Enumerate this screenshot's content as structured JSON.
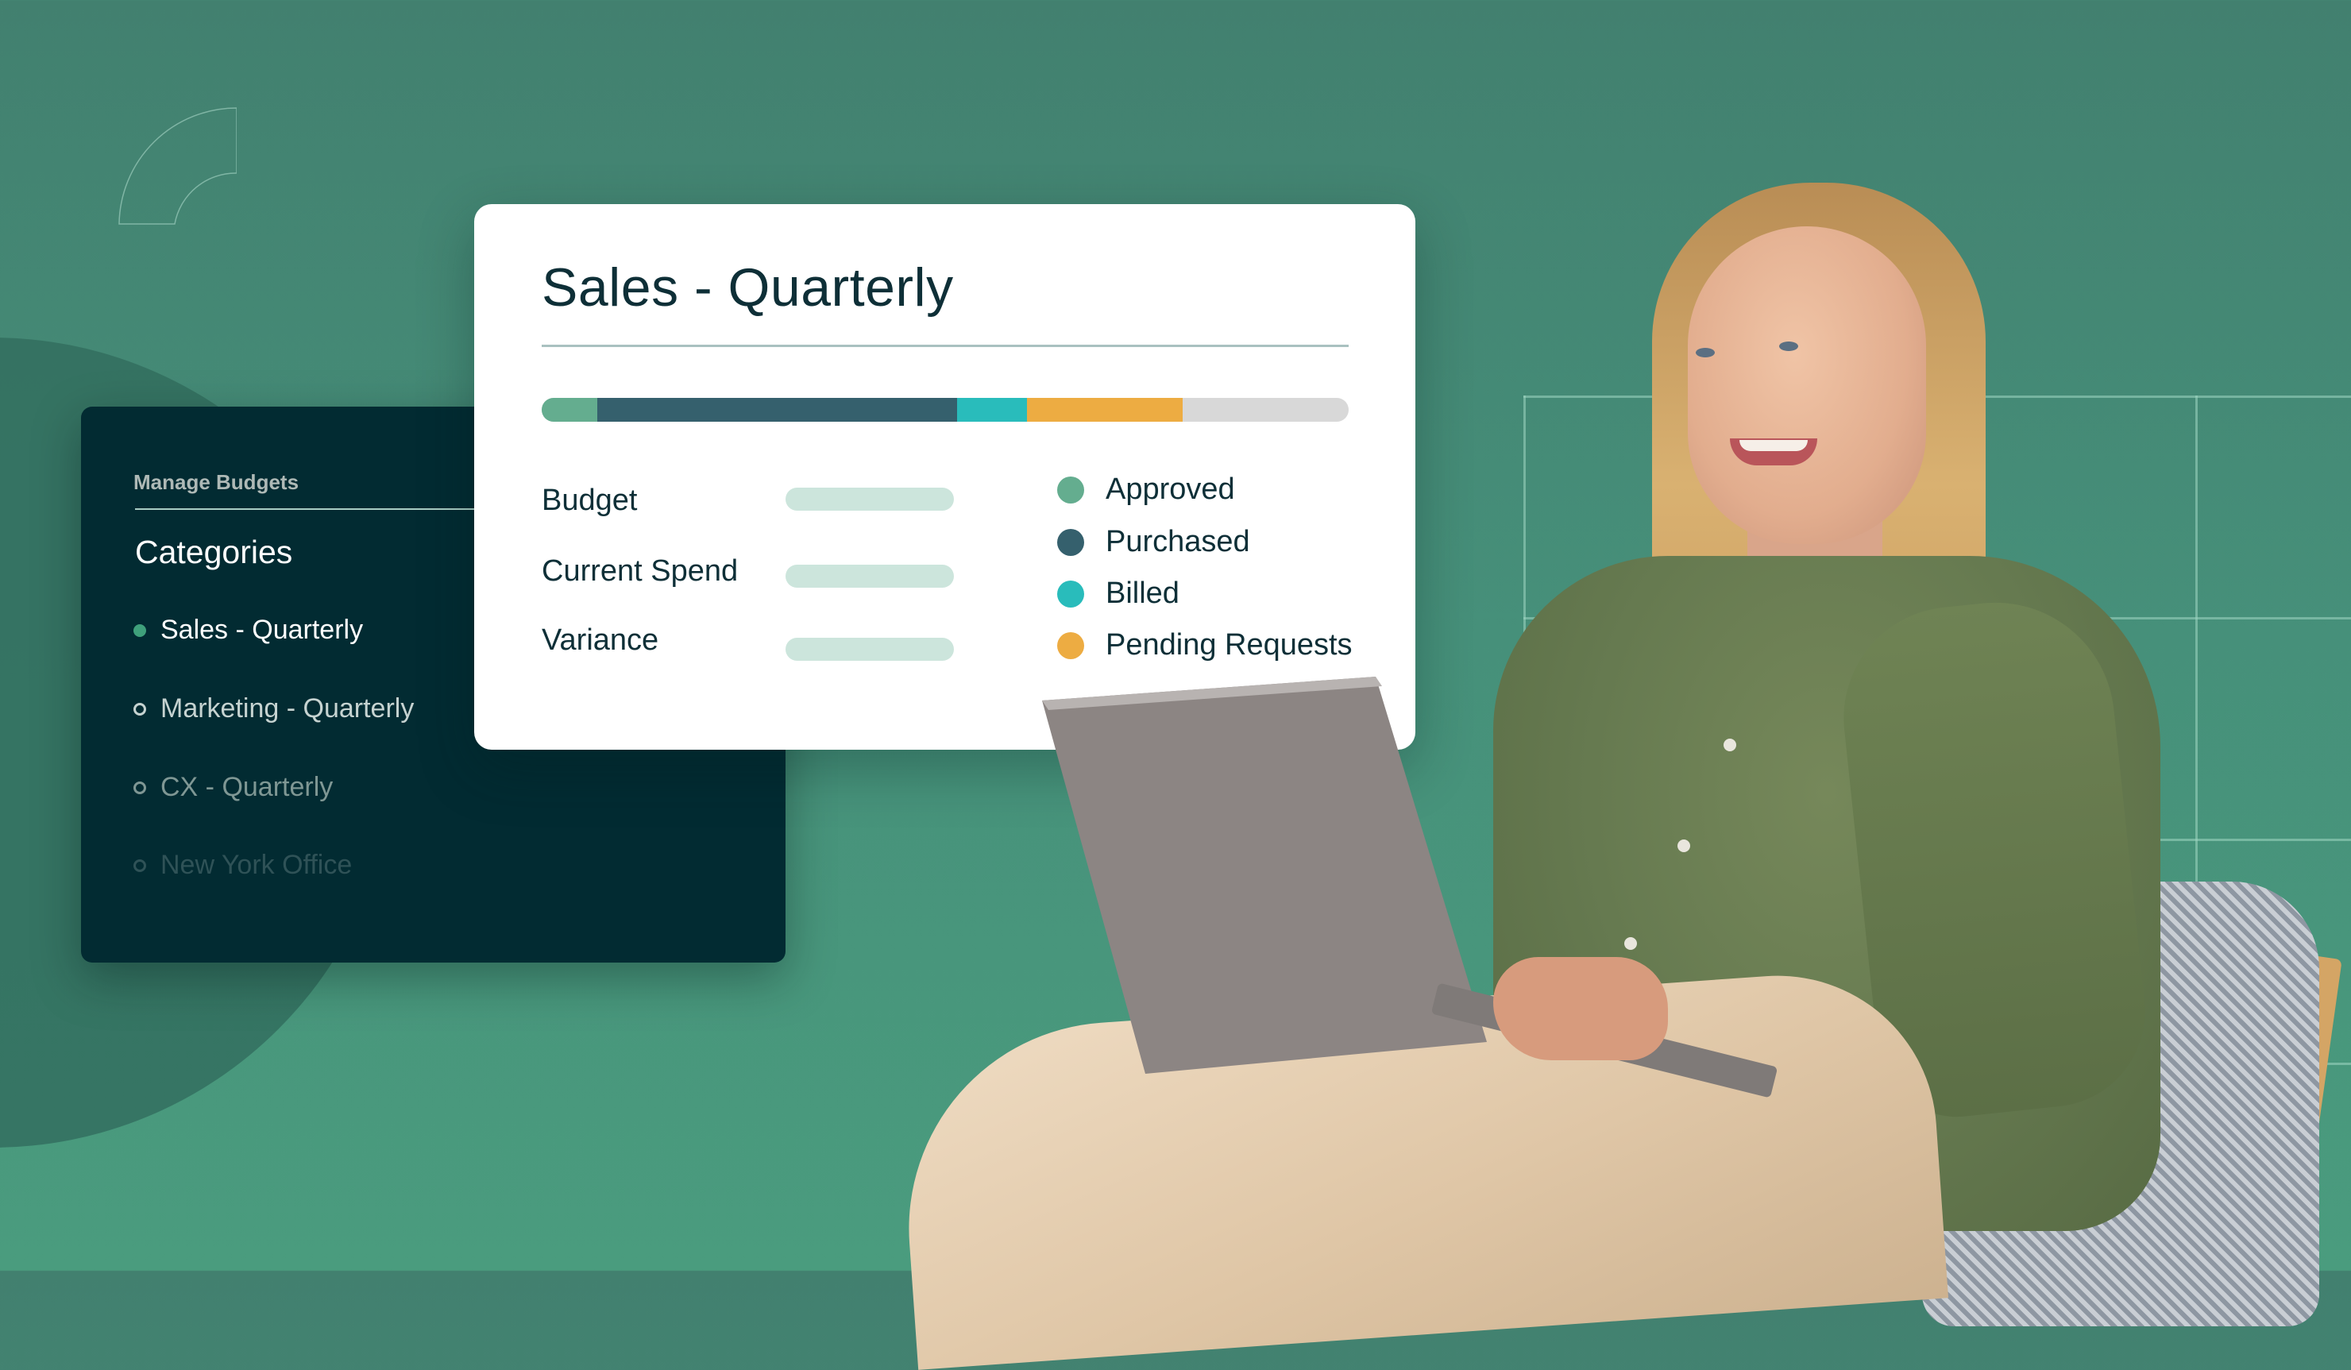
{
  "sidebar": {
    "heading": "Manage Budgets",
    "title": "Categories",
    "items": [
      {
        "label": "Sales - Quarterly",
        "state": "active",
        "color": "#3fa07b"
      },
      {
        "label": "Marketing - Quarterly",
        "state": "inactive"
      },
      {
        "label": "CX - Quarterly",
        "state": "inactive"
      },
      {
        "label": "New York Office",
        "state": "inactive"
      }
    ]
  },
  "card": {
    "title": "Sales - Quarterly",
    "progress": {
      "segments": [
        {
          "name": "Approved",
          "fraction": 0.069,
          "color": "#64ad8f"
        },
        {
          "name": "Purchased",
          "fraction": 0.446,
          "color": "#35606d"
        },
        {
          "name": "Billed",
          "fraction": 0.086,
          "color": "#29bcbb"
        },
        {
          "name": "Pending Requests",
          "fraction": 0.193,
          "color": "#edac42"
        }
      ],
      "remaining_color": "#d8d8d8"
    },
    "rows": [
      {
        "label": "Budget"
      },
      {
        "label": "Current Spend"
      },
      {
        "label": "Variance"
      }
    ],
    "legend": [
      {
        "label": "Approved",
        "color": "#64ad8f"
      },
      {
        "label": "Purchased",
        "color": "#35606d"
      },
      {
        "label": "Billed",
        "color": "#29bcbb"
      },
      {
        "label": "Pending Requests",
        "color": "#edac42"
      }
    ]
  },
  "colors": {
    "background": "#45887a",
    "panel": "#022b32",
    "card_text": "#0e2f37"
  }
}
